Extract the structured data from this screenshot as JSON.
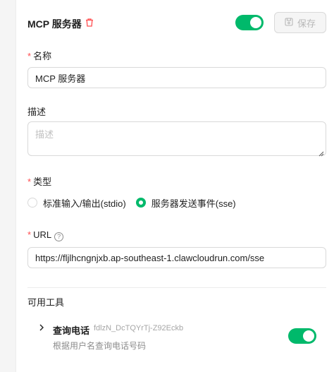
{
  "server": {
    "title": "MCP 服务器",
    "enabled": true,
    "save_label": "保存"
  },
  "form": {
    "name": {
      "label": "名称",
      "required": true,
      "value": "MCP 服务器"
    },
    "description": {
      "label": "描述",
      "placeholder": "描述",
      "value": ""
    },
    "type": {
      "label": "类型",
      "required": true,
      "options": [
        {
          "label": "标准输入/输出(stdio)",
          "checked": false
        },
        {
          "label": "服务器发送事件(sse)",
          "checked": true
        }
      ]
    },
    "url": {
      "label": "URL",
      "required": true,
      "value": "https://fljlhcngnjxb.ap-southeast-1.clawcloudrun.com/sse"
    }
  },
  "tools": {
    "title": "可用工具",
    "items": [
      {
        "name": "查询电话",
        "id": "fdlzN_DcTQYrTj-Z92Eckb",
        "description": "根据用户名查询电话号码",
        "enabled": true
      }
    ]
  },
  "colors": {
    "accent": "#00b96b",
    "required": "#ff4d4f",
    "danger": "#ff4d4f"
  }
}
